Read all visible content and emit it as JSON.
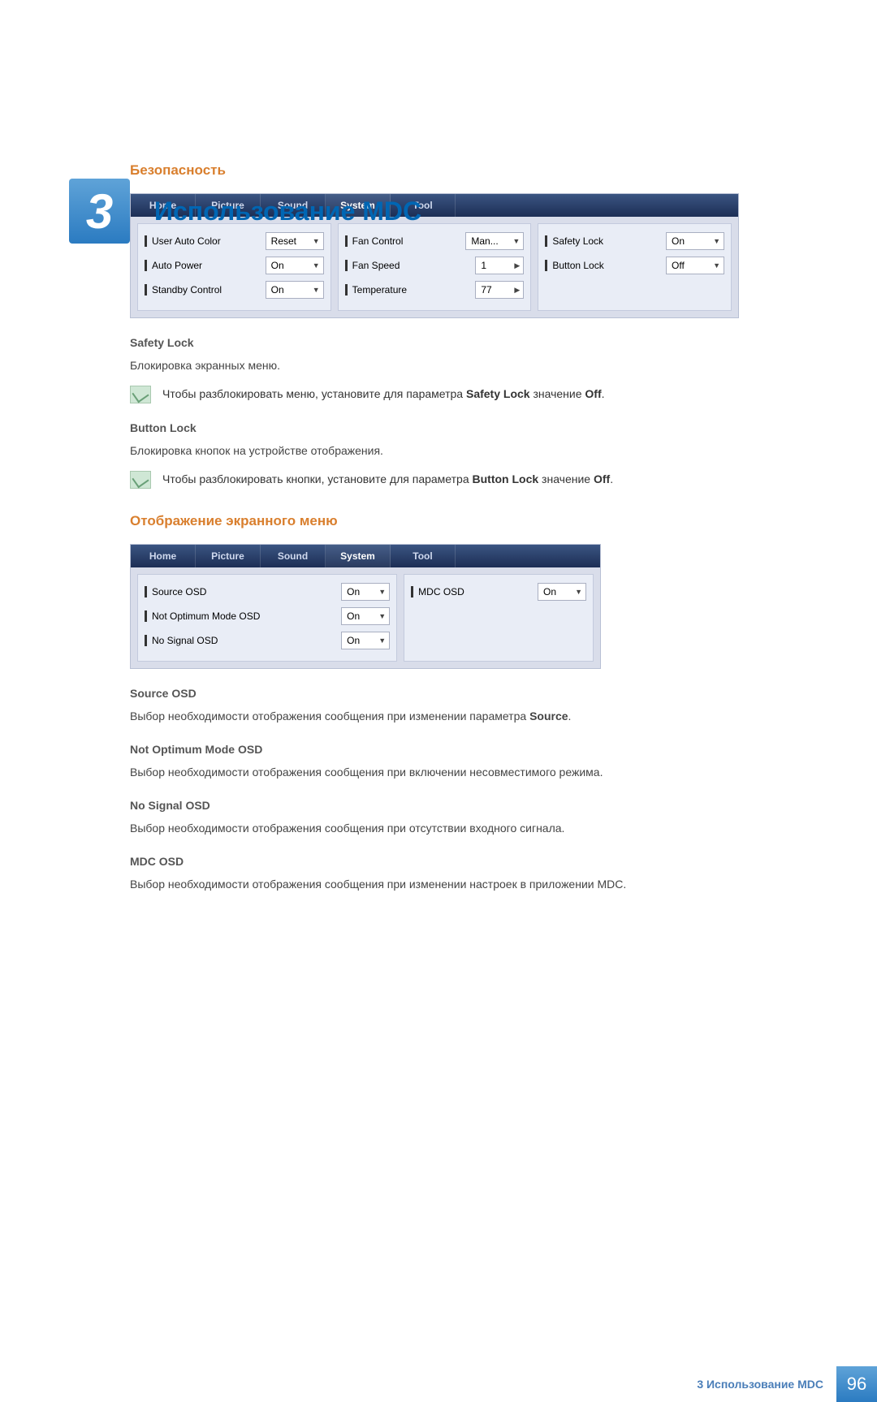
{
  "chapter_number": "3",
  "page_title": "Использование MDC",
  "section_safety": "Безопасность",
  "panel1": {
    "tabs": [
      "Home",
      "Picture",
      "Sound",
      "System",
      "Tool"
    ],
    "col1": [
      {
        "label": "User Auto Color",
        "value": "Reset"
      },
      {
        "label": "Auto Power",
        "value": "On"
      },
      {
        "label": "Standby Control",
        "value": "On"
      }
    ],
    "col2": [
      {
        "label": "Fan Control",
        "value": "Man..."
      },
      {
        "label": "Fan Speed",
        "value": "1",
        "arrow": true
      },
      {
        "label": "Temperature",
        "value": "77",
        "arrow": true
      }
    ],
    "col3": [
      {
        "label": "Safety Lock",
        "value": "On"
      },
      {
        "label": "Button Lock",
        "value": "Off"
      }
    ]
  },
  "safety_lock": {
    "heading": "Safety Lock",
    "body": "Блокировка экранных меню.",
    "note_pre": "Чтобы разблокировать меню, установите для параметра ",
    "note_bold1": "Safety Lock",
    "note_mid": " значение ",
    "note_bold2": "Off",
    "note_end": "."
  },
  "button_lock": {
    "heading": "Button Lock",
    "body": "Блокировка кнопок на устройстве отображения.",
    "note_pre": "Чтобы разблокировать кнопки, установите для параметра ",
    "note_bold1": "Button Lock",
    "note_mid": " значение ",
    "note_bold2": "Off",
    "note_end": "."
  },
  "section_osd": "Отображение экранного меню",
  "panel2": {
    "tabs": [
      "Home",
      "Picture",
      "Sound",
      "System",
      "Tool"
    ],
    "col1": [
      {
        "label": "Source OSD",
        "value": "On"
      },
      {
        "label": "Not Optimum Mode OSD",
        "value": "On"
      },
      {
        "label": "No Signal OSD",
        "value": "On"
      }
    ],
    "col2": [
      {
        "label": "MDC OSD",
        "value": "On"
      }
    ]
  },
  "source_osd": {
    "heading": "Source OSD",
    "body_pre": "Выбор необходимости отображения сообщения при изменении параметра ",
    "body_bold": "Source",
    "body_end": "."
  },
  "not_opt": {
    "heading": "Not Optimum Mode OSD",
    "body": "Выбор необходимости отображения сообщения при включении несовместимого режима."
  },
  "no_signal": {
    "heading": "No Signal OSD",
    "body": "Выбор необходимости отображения сообщения при отсутствии входного сигнала."
  },
  "mdc_osd": {
    "heading": "MDC OSD",
    "body": "Выбор необходимости отображения сообщения при изменении настроек в приложении MDC."
  },
  "footer_crumb": "3 Использование MDC",
  "footer_page": "96"
}
